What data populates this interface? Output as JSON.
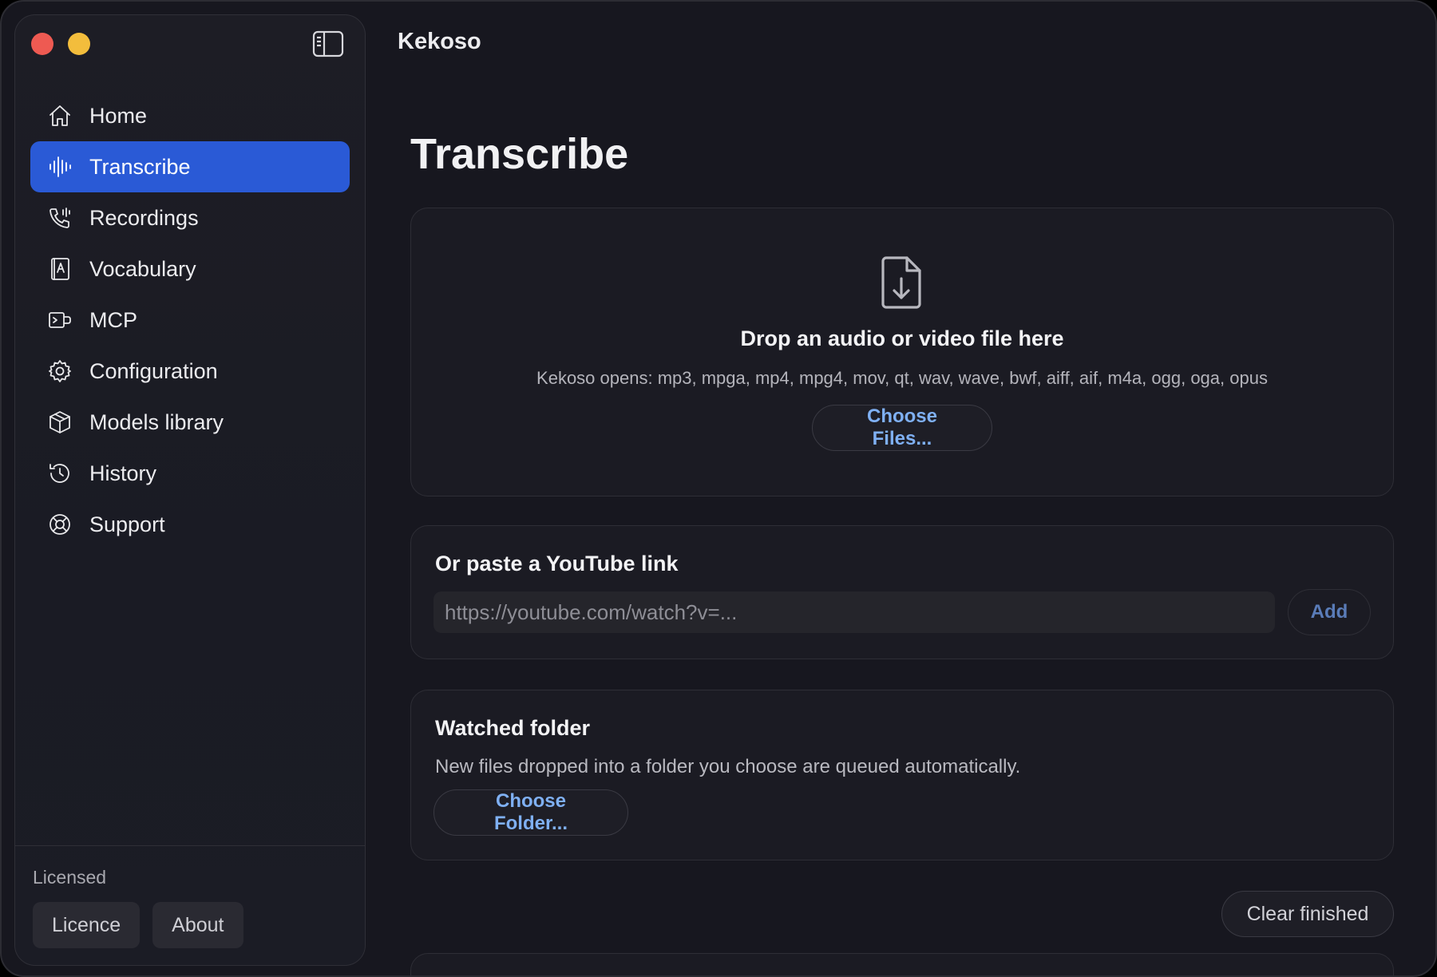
{
  "sidebar": {
    "items": [
      {
        "label": "Home",
        "icon": "home-icon"
      },
      {
        "label": "Transcribe",
        "icon": "waveform-icon",
        "active": true
      },
      {
        "label": "Recordings",
        "icon": "phone-recording-icon"
      },
      {
        "label": "Vocabulary",
        "icon": "dictionary-icon"
      },
      {
        "label": "MCP",
        "icon": "plug-icon"
      },
      {
        "label": "Configuration",
        "icon": "gear-icon"
      },
      {
        "label": "Models library",
        "icon": "cube-icon"
      },
      {
        "label": "History",
        "icon": "clock-history-icon"
      },
      {
        "label": "Support",
        "icon": "lifebuoy-icon"
      }
    ],
    "footer": {
      "status": "Licensed",
      "licence_label": "Licence",
      "about_label": "About"
    }
  },
  "header": {
    "app_title": "Kekoso"
  },
  "main": {
    "page_title": "Transcribe",
    "drop_zone": {
      "title": "Drop an audio or video file here",
      "formats": "Kekoso opens: mp3, mpga, mp4, mpg4, mov, qt, wav, wave, bwf, aiff, aif, m4a, ogg, oga, opus",
      "button_label": "Choose Files..."
    },
    "youtube": {
      "heading": "Or paste a YouTube link",
      "placeholder": "https://youtube.com/watch?v=...",
      "add_label": "Add"
    },
    "watched_folder": {
      "heading": "Watched folder",
      "description": "New files dropped into a folder you choose are queued automatically.",
      "button_label": "Choose Folder..."
    },
    "clear_label": "Clear finished"
  },
  "colors": {
    "accent": "#2a5ad6",
    "link": "#7fb0f3",
    "close": "#ee5a52",
    "minimize": "#f3bd3c"
  }
}
